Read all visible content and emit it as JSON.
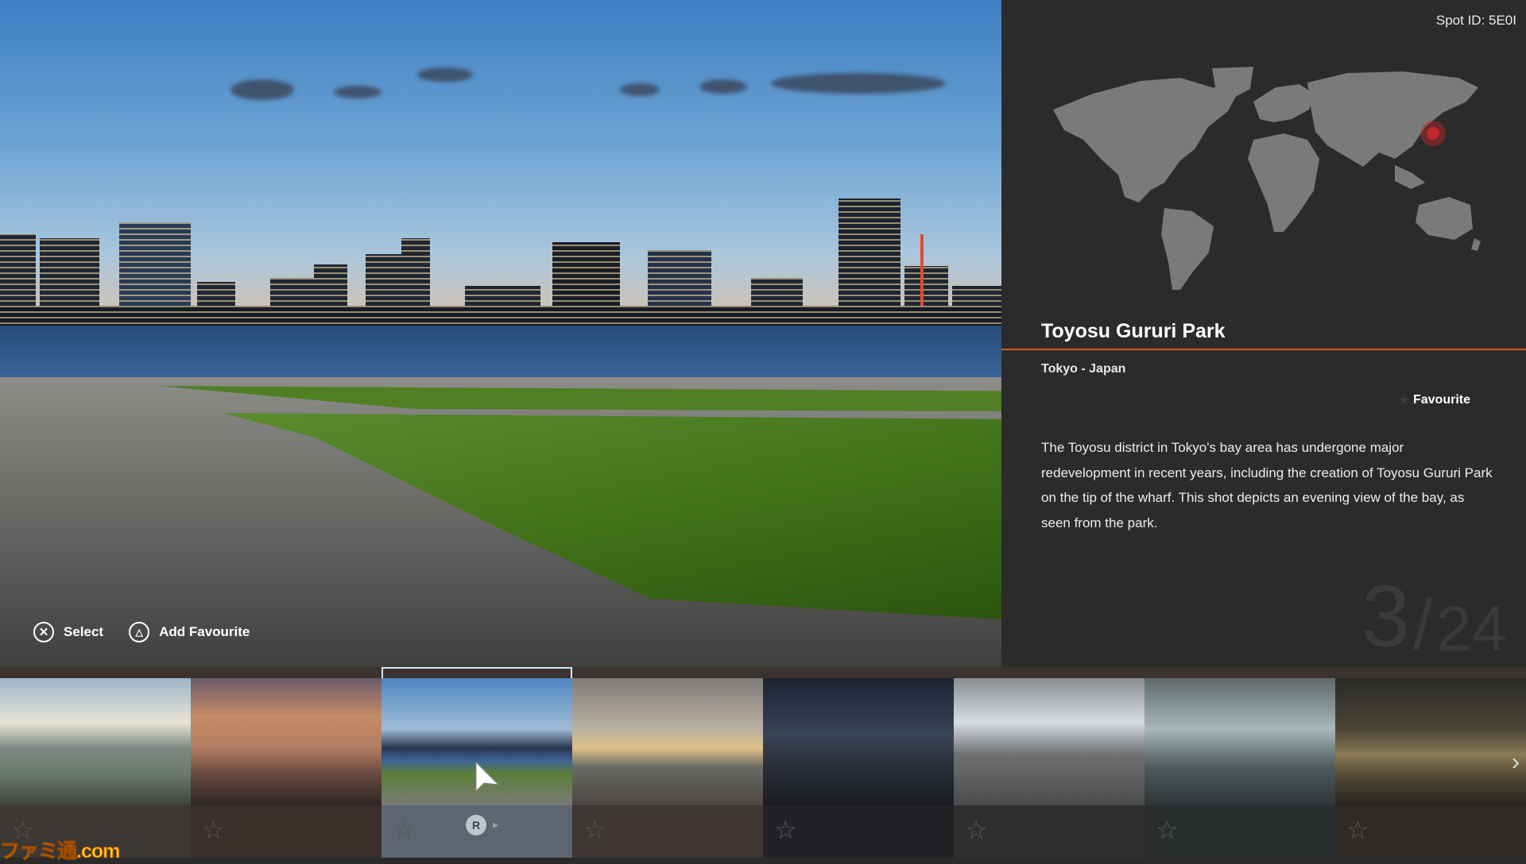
{
  "spot_id": "Spot ID: 5E0I",
  "title": "Toyosu Gururi Park",
  "location": "Tokyo - Japan",
  "favourite_label": "Favourite",
  "description": "The Toyosu district in Tokyo's bay area has undergone major redevelopment in recent years, including the creation of Toyosu Gururi Park on the tip of the wharf. This shot depicts an evening view of the bay, as seen from the park.",
  "counter": {
    "current": "3",
    "separator": "/",
    "total": "24"
  },
  "controls": [
    {
      "icon": "cross-button-icon",
      "label": "Select"
    },
    {
      "icon": "triangle-button-icon",
      "label": "Add Favourite"
    }
  ],
  "thumbnail_button": "R",
  "watermark": "ファミ通.com",
  "accent_color": "#d9591c",
  "map_marker_color": "#c0282a",
  "thumbnails": [
    {
      "name": "bridge-sunrise",
      "favourite": false
    },
    {
      "name": "bay-sunset",
      "favourite": false
    },
    {
      "name": "toyosu-evening",
      "favourite": false,
      "selected": true
    },
    {
      "name": "harbour-dusk",
      "favourite": false
    },
    {
      "name": "industrial-night",
      "favourite": false
    },
    {
      "name": "curved-overpass",
      "favourite": false
    },
    {
      "name": "parking-garage",
      "favourite": false
    },
    {
      "name": "rainbow-bridge-night",
      "favourite": false
    }
  ]
}
